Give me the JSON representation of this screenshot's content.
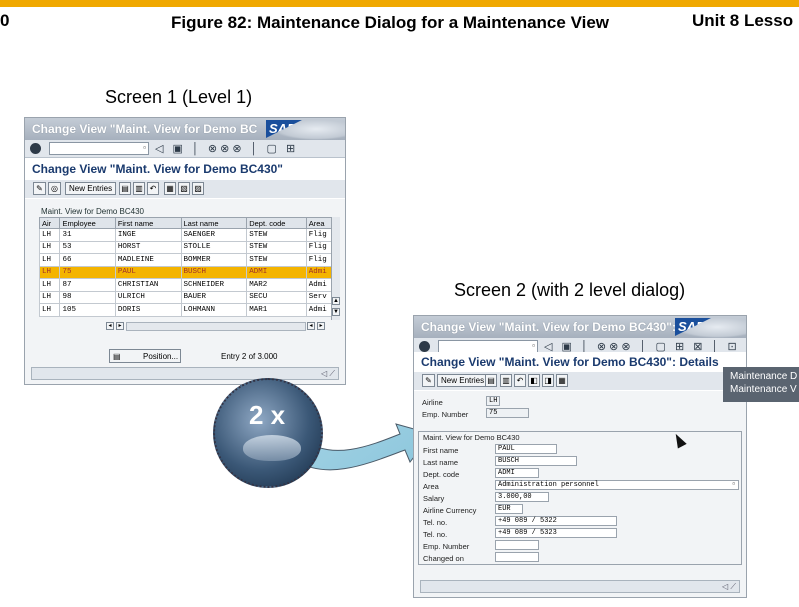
{
  "header": {
    "page_fragment": "0",
    "figure_title": "Figure 82: Maintenance Dialog for a Maintenance View",
    "unit_fragment": "Unit 8 Lesso"
  },
  "captions": {
    "screen1": "Screen 1 (Level 1)",
    "screen2": "Screen 2 (with 2 level dialog)"
  },
  "screen1": {
    "window_title": "Change View \"Maint. View for Demo BC",
    "sap_logo": "SAP",
    "screen_title": "Change View \"Maint. View for Demo BC430\"",
    "new_entries_label": "New Entries",
    "table_caption": "Maint. View for Demo BC430",
    "columns": [
      "Air",
      "Employee",
      "First name",
      "Last name",
      "Dept. code",
      "Area"
    ],
    "rows": [
      [
        "LH",
        "31",
        "INGE",
        "SAENGER",
        "STEW",
        "Flig"
      ],
      [
        "LH",
        "53",
        "HORST",
        "STOLLE",
        "STEW",
        "Flig"
      ],
      [
        "LH",
        "66",
        "MADLEINE",
        "BOMMER",
        "STEW",
        "Flig"
      ],
      [
        "LH",
        "75",
        "PAUL",
        "BUSCH",
        "ADMI",
        "Admi"
      ],
      [
        "LH",
        "87",
        "CHRISTIAN",
        "SCHNEIDER",
        "MAR2",
        "Admi"
      ],
      [
        "LH",
        "98",
        "ULRICH",
        "BAUER",
        "SECU",
        "Serv"
      ],
      [
        "LH",
        "105",
        "DORIS",
        "LOHMANN",
        "MAR1",
        "Admi"
      ]
    ],
    "selected_row": 3,
    "position_button": "Position...",
    "entry_text": "Entry 2",
    "entry_total": "of 3.000"
  },
  "annotation": {
    "label": "2 x"
  },
  "screen2": {
    "window_title": "Change View \"Maint. View for Demo BC430\": D",
    "sap_logo": "SAP",
    "screen_title": "Change View \"Maint. View for Demo BC430\": Details",
    "new_entries_label": "New Entries",
    "key_fields": [
      {
        "label": "Airline",
        "value": "LH"
      },
      {
        "label": "Emp. Number",
        "value": "75"
      }
    ],
    "group_title": "Maint. View for Demo BC430",
    "fields": [
      {
        "label": "First name",
        "value": "PAUL"
      },
      {
        "label": "Last name",
        "value": "BUSCH"
      },
      {
        "label": "Dept. code",
        "value": "ADMI"
      },
      {
        "label": "Area",
        "value": "Administration personnel"
      },
      {
        "label": "Salary",
        "value": "3.000,00"
      },
      {
        "label": "Airline Currency",
        "value": "EUR"
      },
      {
        "label": "Tel. no.",
        "value": "+49 089 / 5322"
      },
      {
        "label": "Tel. no.",
        "value": "+49 089 / 5323"
      },
      {
        "label": "Emp. Number",
        "value": ""
      },
      {
        "label": "Changed on",
        "value": ""
      }
    ]
  },
  "tooltip": {
    "line1": "Maintenance D",
    "line2": "Maintenance V"
  },
  "colors": {
    "accent_bar": "#f0a800",
    "selected_row": "#f4b400",
    "title_blue": "#1a3a6e",
    "sap_blue": "#1a4f9c"
  }
}
